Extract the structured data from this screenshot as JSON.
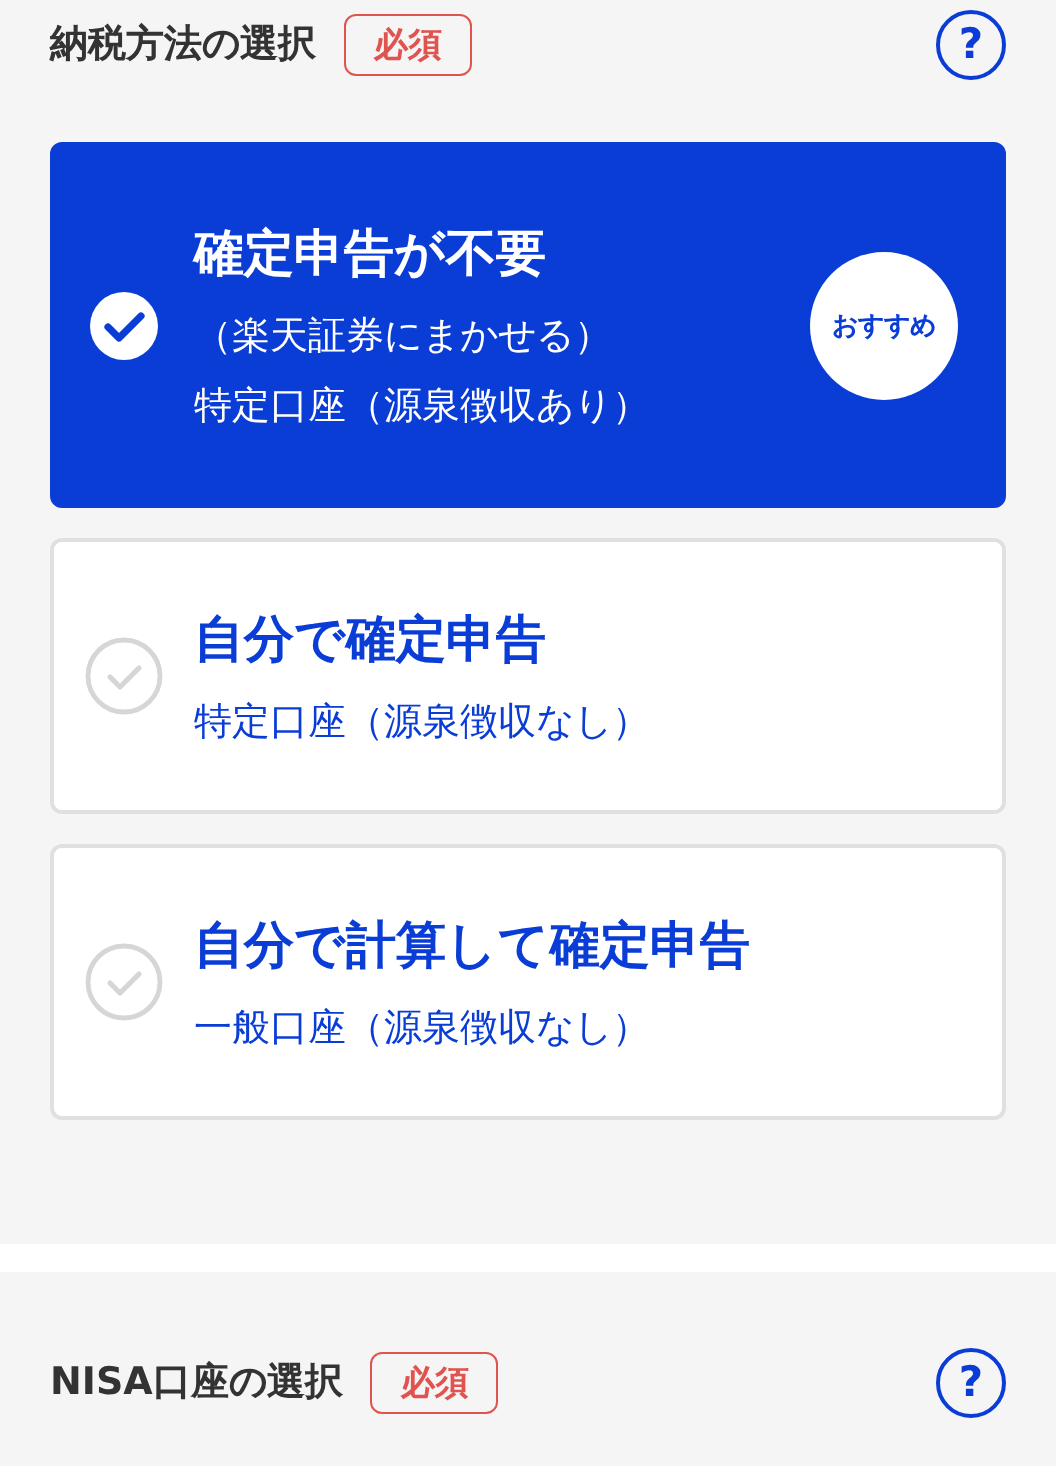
{
  "sections": [
    {
      "title": "納税方法の選択",
      "required_badge": "必須",
      "help": "?",
      "options": [
        {
          "title": "確定申告が不要",
          "lines": [
            "（楽天証券にまかせる）",
            "特定口座（源泉徴収あり）"
          ],
          "badge": "おすすめ",
          "selected": true
        },
        {
          "title": "自分で確定申告",
          "lines": [
            "特定口座（源泉徴収なし）"
          ],
          "selected": false
        },
        {
          "title": "自分で計算して確定申告",
          "lines": [
            "一般口座（源泉徴収なし）"
          ],
          "selected": false
        }
      ]
    },
    {
      "title": "NISA口座の選択",
      "required_badge": "必須",
      "help": "?"
    }
  ]
}
